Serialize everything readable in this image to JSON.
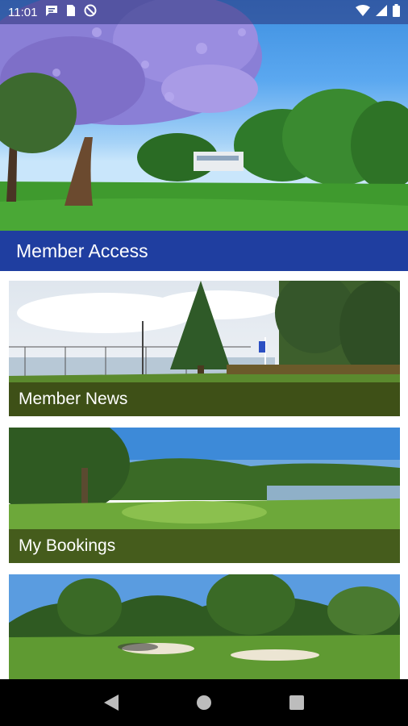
{
  "status_bar": {
    "time": "11:01",
    "left_icons": [
      "message-icon",
      "sim-card-icon",
      "do-not-disturb-icon"
    ],
    "right_icons": [
      "wifi-icon",
      "signal-icon",
      "battery-icon"
    ]
  },
  "header": {
    "title": "Member Access",
    "color": "#1f3ea0"
  },
  "tiles": [
    {
      "label": "Member News"
    },
    {
      "label": "My Bookings"
    },
    {
      "label": ""
    }
  ],
  "nav": {
    "buttons": [
      "back-icon",
      "home-icon",
      "recents-icon"
    ]
  }
}
